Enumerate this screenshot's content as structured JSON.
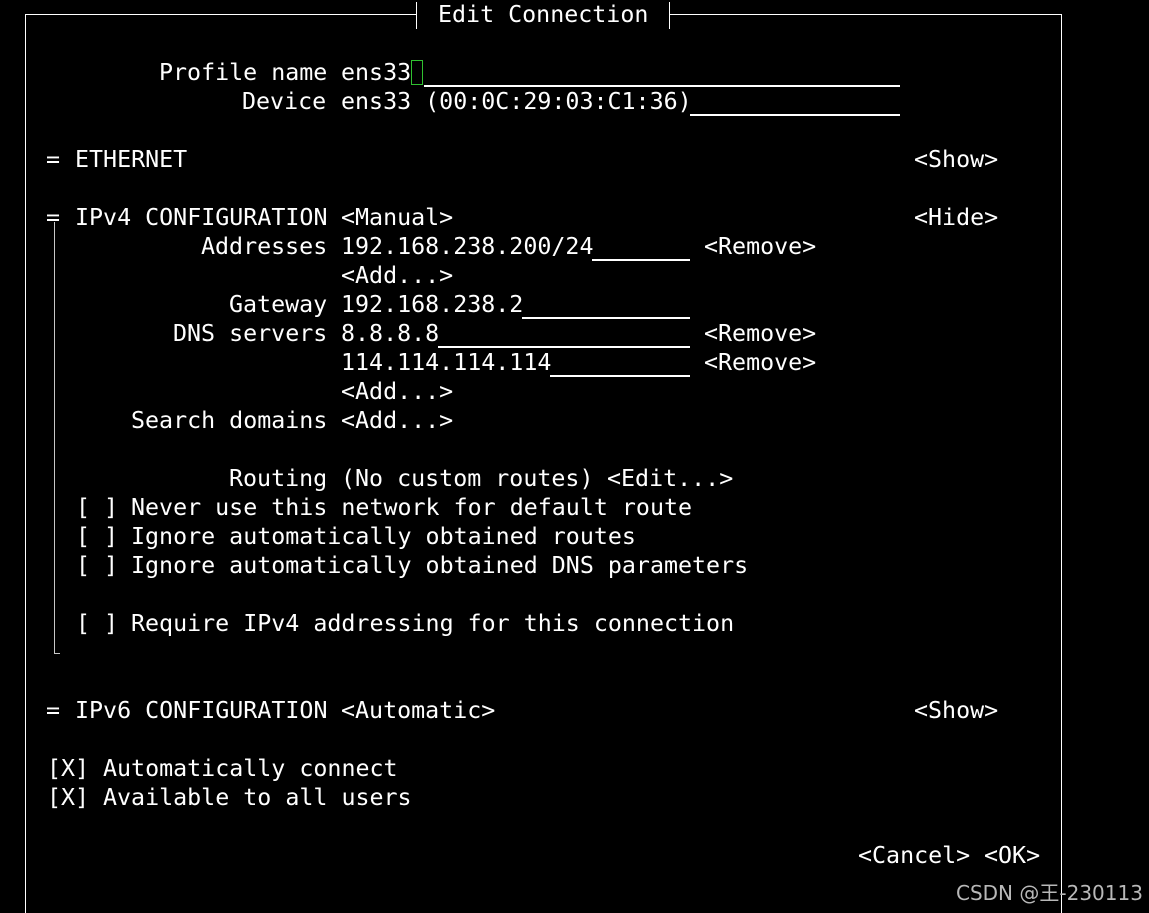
{
  "dialog": {
    "title": "Edit Connection"
  },
  "profile": {
    "label": "Profile name",
    "value": "ens33"
  },
  "device": {
    "label": "Device",
    "value": "ens33 (00:0C:29:03:C1:36)"
  },
  "ethernet": {
    "marker": "=",
    "label": "ETHERNET",
    "toggle": "<Show>"
  },
  "ipv4": {
    "marker": "=",
    "label": "IPv4 CONFIGURATION",
    "method": "<Manual>",
    "toggle": "<Hide>",
    "addresses_label": "Addresses",
    "addresses": [
      "192.168.238.200/24"
    ],
    "gateway_label": "Gateway",
    "gateway": "192.168.238.2",
    "dns_label": "DNS servers",
    "dns": [
      "8.8.8.8",
      "114.114.114.114"
    ],
    "search_label": "Search domains",
    "routing_label": "Routing",
    "routing_value": "(No custom routes)",
    "edit": "<Edit...>",
    "add": "<Add...>",
    "remove": "<Remove>",
    "options": [
      {
        "box": "[ ]",
        "label": "Never use this network for default route",
        "checked": false
      },
      {
        "box": "[ ]",
        "label": "Ignore automatically obtained routes",
        "checked": false
      },
      {
        "box": "[ ]",
        "label": "Ignore automatically obtained DNS parameters",
        "checked": false
      },
      {
        "box": "[ ]",
        "label": "Require IPv4 addressing for this connection",
        "checked": false
      }
    ]
  },
  "ipv6": {
    "marker": "=",
    "label": "IPv6 CONFIGURATION",
    "method": "<Automatic>",
    "toggle": "<Show>"
  },
  "general": [
    {
      "box": "[X]",
      "label": "Automatically connect",
      "checked": true
    },
    {
      "box": "[X]",
      "label": "Available to all users",
      "checked": true
    }
  ],
  "footer": {
    "cancel": "<Cancel>",
    "ok": "<OK>"
  },
  "watermark": "CSDN @王-230113",
  "colors": {
    "background": "#000000",
    "foreground": "#ffffff",
    "cursor": "#30c030"
  }
}
